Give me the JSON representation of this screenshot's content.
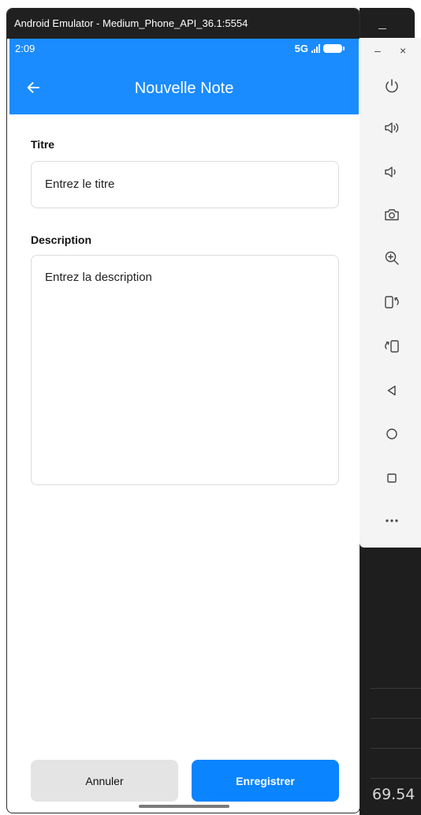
{
  "window": {
    "title": "Android Emulator - Medium_Phone_API_36.1:5554",
    "minimize_label": "–",
    "close_label": "×"
  },
  "status_bar": {
    "time": "2:09",
    "network": "5G"
  },
  "app_bar": {
    "title": "Nouvelle Note",
    "back_icon": "arrow-left-icon"
  },
  "form": {
    "title_label": "Titre",
    "title_placeholder": "Entrez le titre",
    "description_label": "Description",
    "description_placeholder": "Entrez la description"
  },
  "actions": {
    "cancel_label": "Annuler",
    "save_label": "Enregistrer"
  },
  "toolbar": {
    "items": [
      "power-icon",
      "volume-up-icon",
      "volume-down-icon",
      "camera-icon",
      "zoom-in-icon",
      "rotate-left-icon",
      "rotate-right-icon",
      "back-icon",
      "home-icon",
      "overview-icon",
      "more-icon"
    ]
  },
  "host": {
    "partial_value": "69.54"
  },
  "colors": {
    "primary": "#1a8cff",
    "save_button": "#0a84ff",
    "cancel_button": "#e4e4e4"
  }
}
